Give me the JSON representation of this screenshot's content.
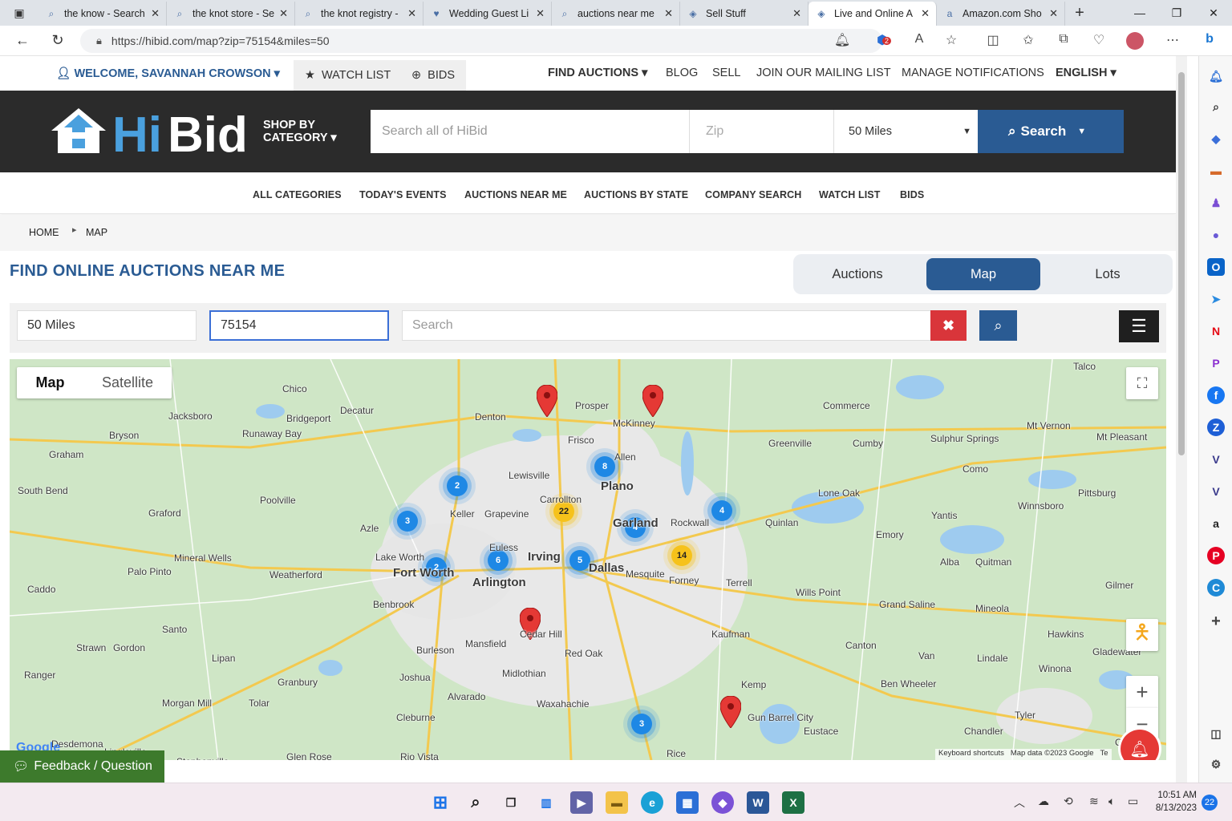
{
  "browser": {
    "tabs": [
      {
        "title": "the know - Search",
        "icon": "search-icon"
      },
      {
        "title": "the knot store - Se",
        "icon": "search-icon"
      },
      {
        "title": "the knot registry -",
        "icon": "search-icon"
      },
      {
        "title": "Wedding Guest Li",
        "icon": "knot-icon"
      },
      {
        "title": "auctions near me",
        "icon": "search-icon"
      },
      {
        "title": "Sell Stuff",
        "icon": "hibid-icon"
      },
      {
        "title": "Live and Online A",
        "icon": "hibid-icon",
        "active": true
      },
      {
        "title": "Amazon.com Sho",
        "icon": "amazon-icon"
      }
    ],
    "url": "https://hibid.com/map?zip=75154&miles=50",
    "notif_badge": "2"
  },
  "userbar": {
    "welcome": "WELCOME, SAVANNAH CROWSON",
    "watch_list": "WATCH LIST",
    "bids": "BIDS",
    "links": [
      "FIND AUCTIONS",
      "BLOG",
      "SELL",
      "JOIN OUR MAILING LIST",
      "MANAGE NOTIFICATIONS",
      "ENGLISH"
    ]
  },
  "header": {
    "logo_text": "HiBid",
    "shop_by_1": "SHOP BY",
    "shop_by_2": "CATEGORY",
    "search_placeholder": "Search all of HiBid",
    "zip_placeholder": "Zip",
    "miles": "50 Miles",
    "search_button": "Search"
  },
  "nav": [
    "ALL CATEGORIES",
    "TODAY'S EVENTS",
    "AUCTIONS NEAR ME",
    "AUCTIONS BY STATE",
    "COMPANY SEARCH",
    "WATCH LIST",
    "BIDS"
  ],
  "breadcrumb": {
    "home": "HOME",
    "current": "MAP"
  },
  "page_title": "FIND ONLINE AUCTIONS NEAR ME",
  "view_toggle": [
    "Auctions",
    "Map",
    "Lots"
  ],
  "view_selected": "Map",
  "filters": {
    "miles": "50 Miles",
    "zip": "75154",
    "search_placeholder": "Search"
  },
  "map": {
    "type_buttons": [
      "Map",
      "Satellite"
    ],
    "type_selected": "Map",
    "clusters": [
      {
        "count": "2",
        "color": "blue"
      },
      {
        "count": "8",
        "color": "blue"
      },
      {
        "count": "3",
        "color": "blue"
      },
      {
        "count": "22",
        "color": "yellow"
      },
      {
        "count": "4",
        "color": "blue"
      },
      {
        "count": "4",
        "color": "blue"
      },
      {
        "count": "6",
        "color": "blue"
      },
      {
        "count": "5",
        "color": "blue"
      },
      {
        "count": "14",
        "color": "yellow"
      },
      {
        "count": "2",
        "color": "blue"
      },
      {
        "count": "3",
        "color": "blue"
      }
    ],
    "cities": [
      "Chico",
      "Decatur",
      "Denton",
      "Prosper",
      "McKinney",
      "Commerce",
      "Talco",
      "Jacksboro",
      "Bridgeport",
      "Frisco",
      "Allen",
      "Greenville",
      "Cumby",
      "Sulphur Springs",
      "Mt Vernon",
      "Mt Pleasant",
      "Bryson",
      "Runaway Bay",
      "Graham",
      "Lewisville",
      "Plano",
      "Como",
      "Pittsburg",
      "South Bend",
      "Poolville",
      "Keller",
      "Grapevine",
      "Carrollton",
      "Lone Oak",
      "Yantis",
      "Winnsboro",
      "Graford",
      "Azle",
      "Garland",
      "Rockwall",
      "Quinlan",
      "Emory",
      "Lake Worth",
      "Irving",
      "Euless",
      "Mineral Wells",
      "Fort Worth",
      "Arlington",
      "Dallas",
      "Mesquite",
      "Alba",
      "Quitman",
      "Palo Pinto",
      "Weatherford",
      "Forney",
      "Terrell",
      "Wills Point",
      "Grand Saline",
      "Mineola",
      "Gilmer",
      "Caddo",
      "Benbrook",
      "Santo",
      "Mansfield",
      "Cedar Hill",
      "Kaufman",
      "Canton",
      "Hawkins",
      "Strawn",
      "Gordon",
      "Burleson",
      "Red Oak",
      "Van",
      "Lindale",
      "Gladewater",
      "Lipan",
      "Midlothian",
      "Joshua",
      "Winona",
      "Ranger",
      "Granbury",
      "Kemp",
      "Ben Wheeler",
      "Alvarado",
      "Waxahachie",
      "Morgan Mill",
      "Tolar",
      "Tyler",
      "Cleburne",
      "Gun Barrel City",
      "Eustace",
      "Chandler",
      "Desdemona",
      "Glen Rose",
      "Rio Vista",
      "Rice",
      "Lingleville",
      "Stephenville",
      "Overton"
    ],
    "attribution": "Keyboard shortcuts",
    "map_data": "Map data ©2023 Google",
    "terms": "Te",
    "google": "Google"
  },
  "feedback": "Feedback / Question",
  "taskbar": {
    "time": "10:51 AM",
    "date": "8/13/2023",
    "notif": "22"
  },
  "colors": {
    "brand_blue": "#2a5b93",
    "header_dark": "#2b2b2b",
    "marker_red": "#e53935",
    "cluster_blue": "#1e88e5",
    "cluster_yellow": "#f6c21b",
    "feedback_green": "#3d7a2c"
  }
}
